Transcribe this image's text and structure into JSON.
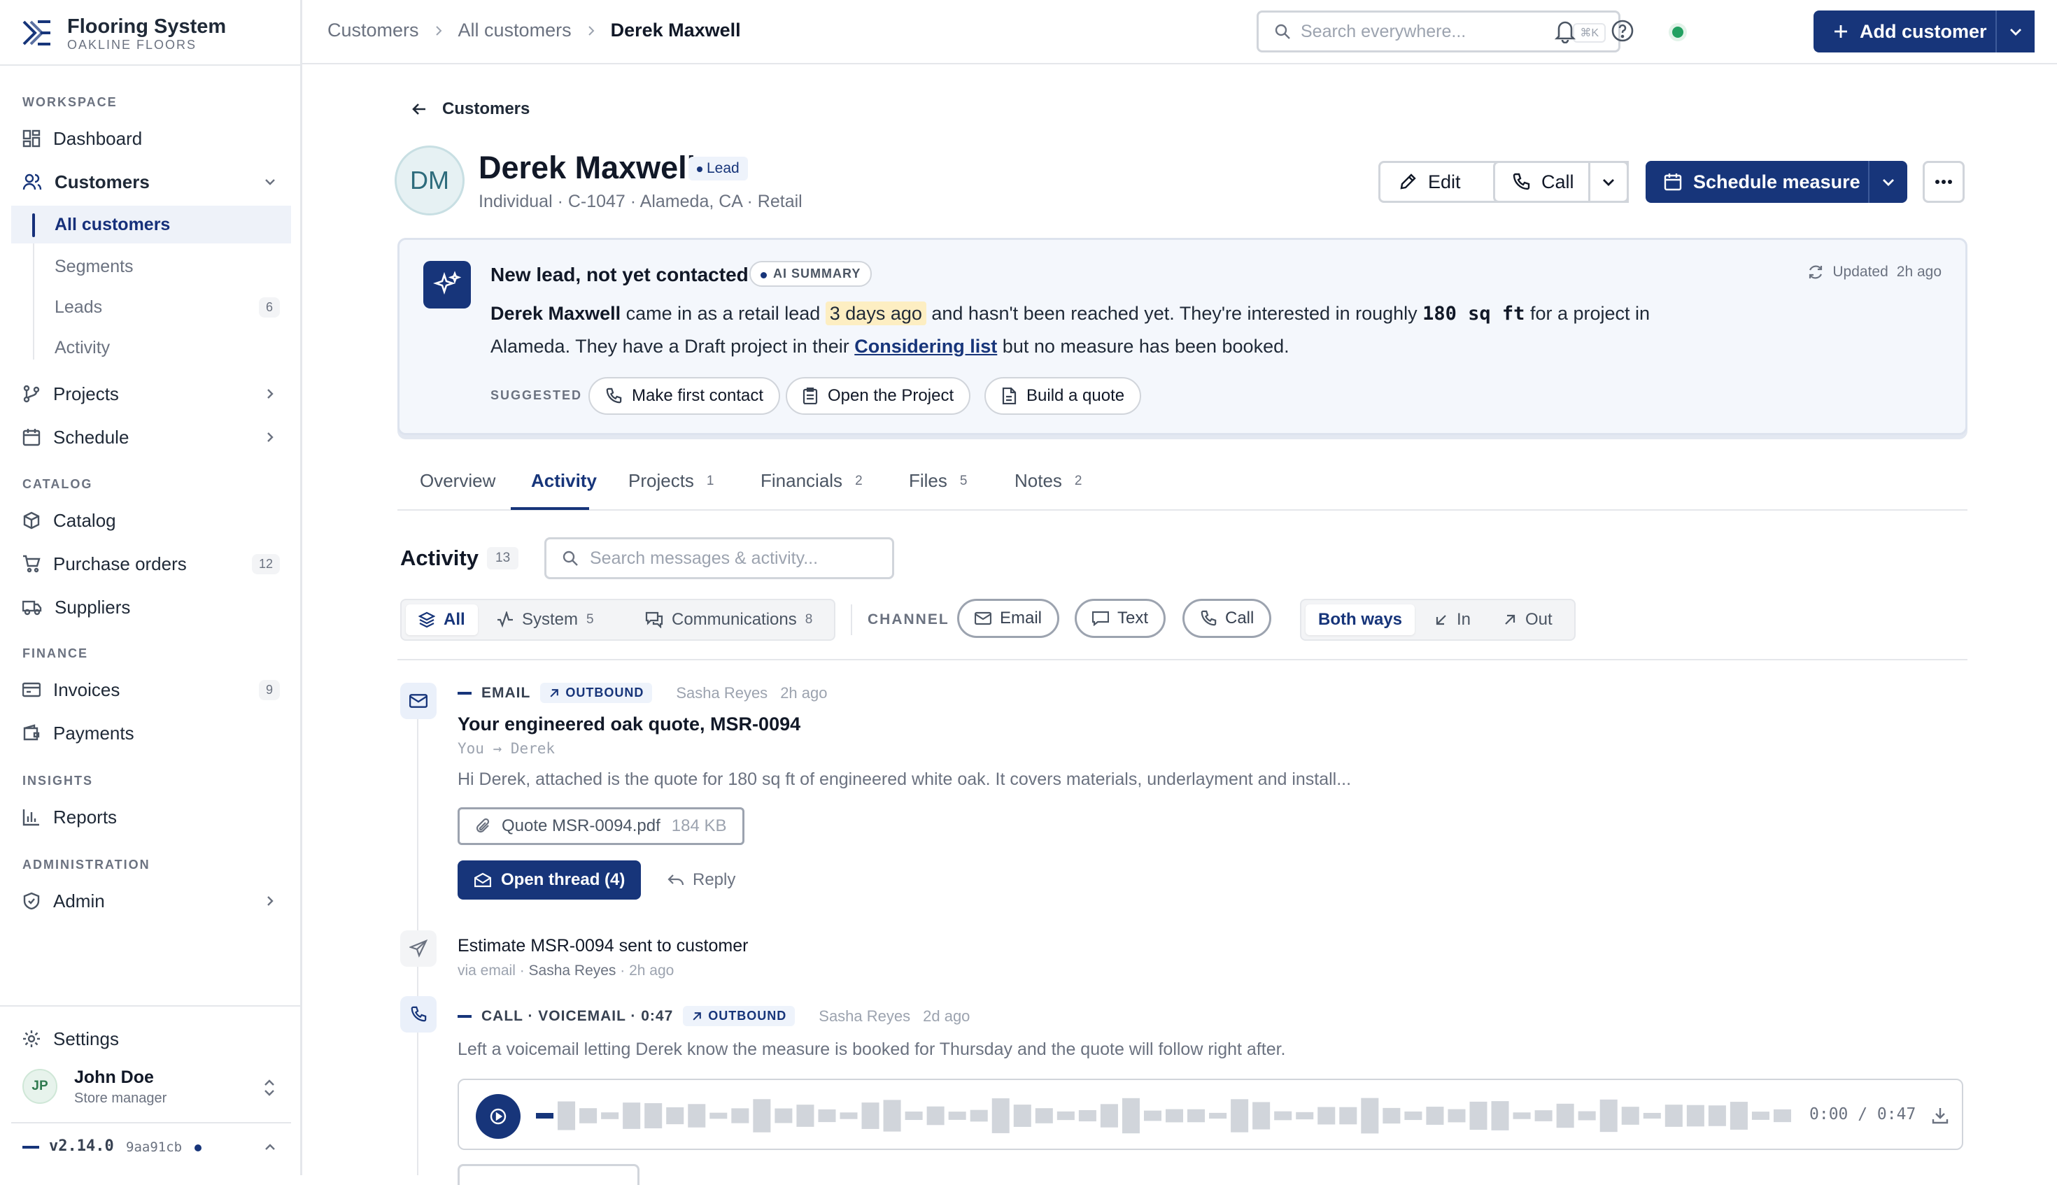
{
  "brand": {
    "name": "Flooring System",
    "sub": "OAKLINE FLOORS"
  },
  "sidebar": {
    "sections": {
      "workspace": "WORKSPACE",
      "catalog": "CATALOG",
      "finance": "FINANCE",
      "insights": "INSIGHTS",
      "administration": "ADMINISTRATION"
    },
    "items": {
      "dashboard": "Dashboard",
      "customers": "Customers",
      "all_customers": "All customers",
      "segments": "Segments",
      "leads": "Leads",
      "leads_count": "6",
      "activity": "Activity",
      "projects": "Projects",
      "schedule": "Schedule",
      "catalog": "Catalog",
      "purchase_orders": "Purchase orders",
      "purchase_orders_count": "12",
      "suppliers": "Suppliers",
      "invoices": "Invoices",
      "invoices_count": "9",
      "payments": "Payments",
      "reports": "Reports",
      "admin": "Admin",
      "settings": "Settings"
    },
    "user": {
      "initials": "JP",
      "name": "John Doe",
      "role": "Store manager"
    },
    "version": {
      "label": "v2.14.0",
      "hash": "9aa91cb"
    }
  },
  "topbar": {
    "breadcrumbs": [
      "Customers",
      "All customers",
      "Derek Maxwell"
    ],
    "search_placeholder": "Search everywhere...",
    "shortcut": "⌘K",
    "add_customer": "Add customer"
  },
  "customer": {
    "back_label": "Customers",
    "initials": "DM",
    "name": "Derek Maxwell",
    "status": "Lead",
    "meta": "Individual · C-1047 · Alameda, CA · Retail",
    "actions": {
      "edit": "Edit",
      "call": "Call",
      "schedule": "Schedule measure"
    }
  },
  "ai_summary": {
    "title": "New lead, not yet contacted",
    "tag": "AI SUMMARY",
    "updated_label": "Updated",
    "updated_time": "2h ago",
    "text": {
      "name": "Derek Maxwell",
      "p1": " came in as a retail lead ",
      "highlight": "3 days ago",
      "p2": " and hasn't been reached yet. They're interested in roughly ",
      "area": "180 sq ft",
      "p3": " for a project in Alameda. They have a Draft project in their ",
      "link": "Considering list",
      "p4": " but no measure has been booked."
    },
    "suggested_label": "SUGGESTED",
    "suggestions": [
      "Make first contact",
      "Open the Project",
      "Build a quote"
    ]
  },
  "tabs": [
    {
      "label": "Overview",
      "count": ""
    },
    {
      "label": "Activity",
      "count": ""
    },
    {
      "label": "Projects",
      "count": "1"
    },
    {
      "label": "Financials",
      "count": "2"
    },
    {
      "label": "Files",
      "count": "5"
    },
    {
      "label": "Notes",
      "count": "2"
    }
  ],
  "activity": {
    "title": "Activity",
    "count": "13",
    "search_placeholder": "Search messages & activity...",
    "filters": {
      "all": "All",
      "system": "System",
      "system_count": "5",
      "communications": "Communications",
      "communications_count": "8"
    },
    "channel_label": "CHANNEL",
    "channels": [
      "Email",
      "Text",
      "Call"
    ],
    "directions": [
      "Both ways",
      "In",
      "Out"
    ],
    "events": {
      "email": {
        "type": "EMAIL",
        "direction": "OUTBOUND",
        "author": "Sasha Reyes",
        "time": "2h  ago",
        "subject": "Your engineered oak quote, MSR-0094",
        "from_to": "You → Derek",
        "preview": "Hi Derek, attached is the quote for 180 sq ft of engineered white oak. It covers materials, underlayment and install...",
        "attachment": "Quote MSR-0094.pdf",
        "attachment_size": "184  KB",
        "open_thread": "Open thread  (4)",
        "reply": "Reply"
      },
      "estimate": {
        "title": "Estimate MSR-0094 sent to customer",
        "meta_via": "via email · ",
        "meta_author": "Sasha Reyes",
        "meta_time": " · 2h  ago"
      },
      "call": {
        "type": "CALL · VOICEMAIL · 0:47",
        "direction": "OUTBOUND",
        "author": "Sasha Reyes",
        "time": "2d  ago",
        "body": "Left a voicemail letting Derek know the measure is booked for Thursday and the quote will follow right after.",
        "player_time": "0:00  /  0:47"
      }
    }
  }
}
